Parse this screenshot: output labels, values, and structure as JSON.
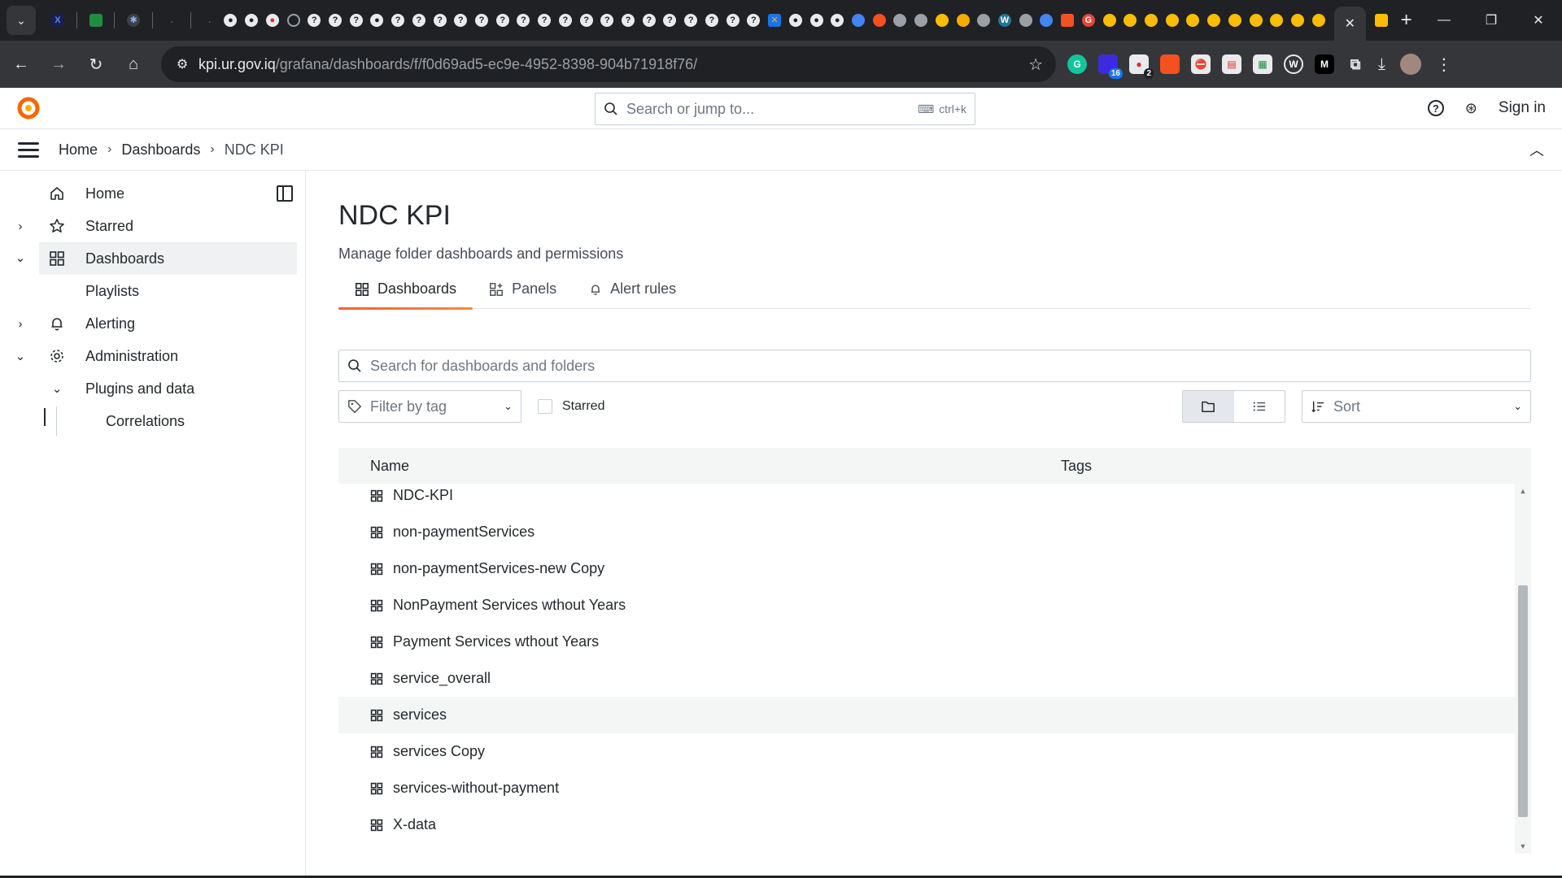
{
  "browser": {
    "url_host": "kpi.ur.gov.iq",
    "url_path": "/grafana/dashboards/f/f0d69ad5-ec9e-4952-8398-904b71918f76/",
    "extension_badges": {
      "first": "16",
      "second": "2"
    },
    "extension_letter_m": "M"
  },
  "grafana": {
    "search_placeholder": "Search or jump to...",
    "search_shortcut": "ctrl+k",
    "sign_in": "Sign in",
    "breadcrumbs": [
      "Home",
      "Dashboards",
      "NDC KPI"
    ],
    "accent_color": "#f55f3e"
  },
  "sidebar": {
    "items": [
      {
        "label": "Home",
        "icon": "home-icon"
      },
      {
        "label": "Starred",
        "icon": "star-icon"
      },
      {
        "label": "Dashboards",
        "icon": "apps-icon",
        "active": true
      },
      {
        "label": "Playlists"
      },
      {
        "label": "Alerting",
        "icon": "bell-icon"
      },
      {
        "label": "Administration",
        "icon": "cog-icon"
      },
      {
        "label": "Plugins and data"
      },
      {
        "label": "Correlations"
      }
    ]
  },
  "main": {
    "title": "NDC KPI",
    "subtitle": "Manage folder dashboards and permissions",
    "tabs": [
      {
        "label": "Dashboards",
        "icon": "apps-icon",
        "active": true
      },
      {
        "label": "Panels",
        "icon": "panel-icon"
      },
      {
        "label": "Alert rules",
        "icon": "bell-icon"
      }
    ],
    "search_placeholder": "Search for dashboards and folders",
    "filter_tag_placeholder": "Filter by tag",
    "starred_label": "Starred",
    "sort_label": "Sort",
    "columns": {
      "name": "Name",
      "tags": "Tags"
    },
    "rows": [
      "NDC-KPI",
      "non-paymentServices",
      "non-paymentServices-new Copy",
      "NonPayment Services wthout Years",
      "Payment Services wthout Years",
      "service_overall",
      "services",
      "services Copy",
      "services-without-payment",
      "X-data"
    ],
    "highlighted_row": "services"
  }
}
